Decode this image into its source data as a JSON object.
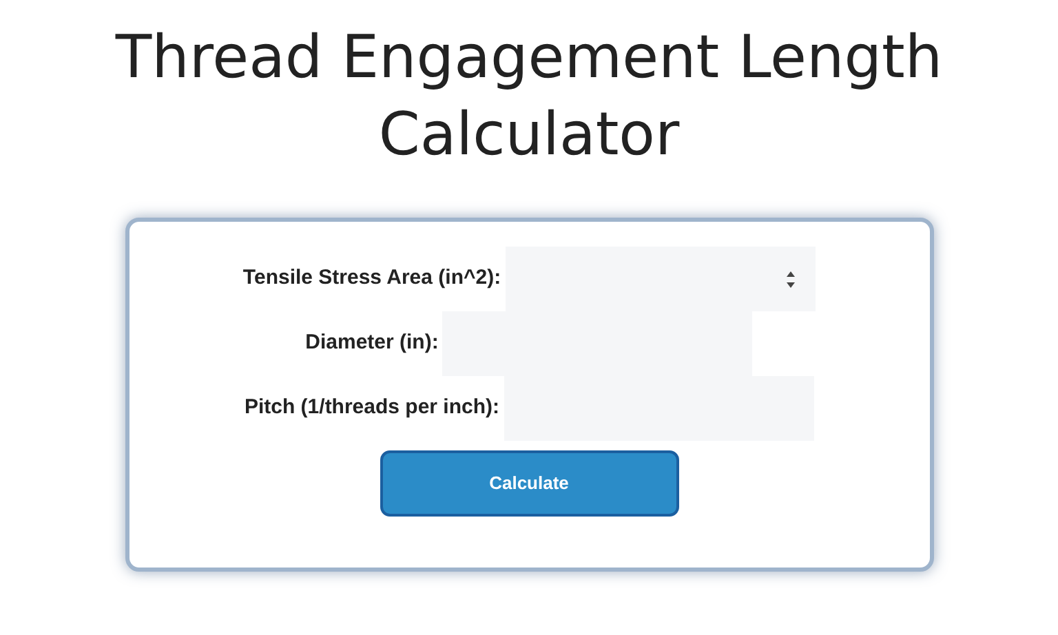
{
  "title": "Thread Engagement Length Calculator",
  "fields": [
    {
      "label": "Tensile Stress Area (in^2):",
      "kind": "number"
    },
    {
      "label": "Diameter (in):",
      "kind": "text"
    },
    {
      "label": "Pitch (1/threads per inch):",
      "kind": "text"
    }
  ],
  "button": "Calculate"
}
